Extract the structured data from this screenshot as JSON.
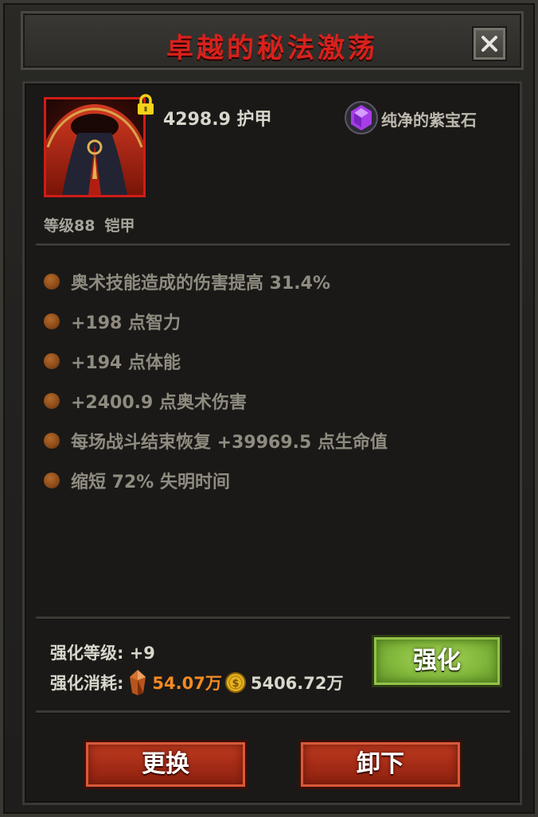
{
  "dialog": {
    "title": "卓越的秘法激荡"
  },
  "item": {
    "armor_value": "4298.9 护甲",
    "gem_label": "纯净的紫宝石",
    "level_label": "等级88",
    "type_label": "铠甲",
    "locked": true
  },
  "stats": [
    "奥术技能造成的伤害提高 31.4%",
    "+198 点智力",
    "+194 点体能",
    "+2400.9 点奥术伤害",
    "每场战斗结束恢复 +39969.5 点生命值",
    "缩短 72% 失明时间"
  ],
  "enhance": {
    "level_text": "强化等级: +9",
    "cost_label": "强化消耗:",
    "crystal_cost": "54.07万",
    "gold_cost": "5406.72万",
    "button_label": "强化"
  },
  "actions": {
    "replace_label": "更换",
    "unequip_label": "卸下"
  },
  "colors": {
    "title": "#d8211c",
    "icon_border": "#d01c18",
    "enhance_button": "#7fb53a",
    "action_button": "#a52c16",
    "crystal_cost": "#f28a23"
  },
  "icons": {
    "close": "close-icon",
    "lock": "lock-icon",
    "gem": "purple-gem-icon",
    "crystal": "crystal-icon",
    "coin": "gold-coin-icon"
  }
}
